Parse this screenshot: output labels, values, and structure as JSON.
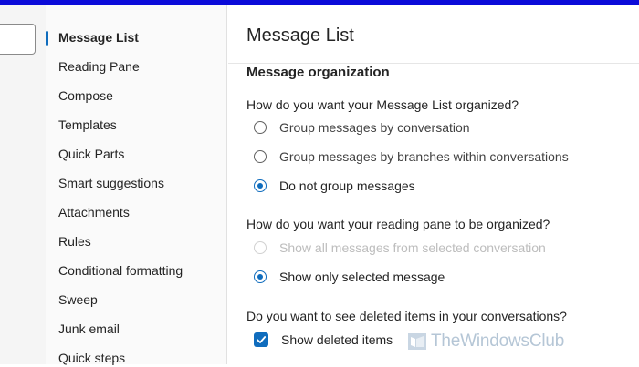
{
  "nav": {
    "items": [
      {
        "label": "Message List",
        "selected": true
      },
      {
        "label": "Reading Pane"
      },
      {
        "label": "Compose"
      },
      {
        "label": "Templates"
      },
      {
        "label": "Quick Parts"
      },
      {
        "label": "Smart suggestions"
      },
      {
        "label": "Attachments"
      },
      {
        "label": "Rules"
      },
      {
        "label": "Conditional formatting"
      },
      {
        "label": "Sweep"
      },
      {
        "label": "Junk email"
      },
      {
        "label": "Quick steps"
      }
    ]
  },
  "main": {
    "title": "Message List",
    "section_title": "Message organization",
    "q1": {
      "question": "How do you want your Message List organized?",
      "options": [
        {
          "label": "Group messages by conversation",
          "checked": false
        },
        {
          "label": "Group messages by branches within conversations",
          "checked": false
        },
        {
          "label": "Do not group messages",
          "checked": true
        }
      ]
    },
    "q2": {
      "question": "How do you want your reading pane to be organized?",
      "options": [
        {
          "label": "Show all messages from selected conversation",
          "checked": false,
          "disabled": true
        },
        {
          "label": "Show only selected message",
          "checked": true
        }
      ]
    },
    "q3": {
      "question": "Do you want to see deleted items in your conversations?",
      "checkbox_label": "Show deleted items",
      "checked": true
    }
  },
  "watermark": {
    "text": "TheWindowsClub"
  },
  "colors": {
    "accent": "#0f6cbd",
    "highlight": "#fcf8b6",
    "topbar": "#0b0bd9"
  }
}
